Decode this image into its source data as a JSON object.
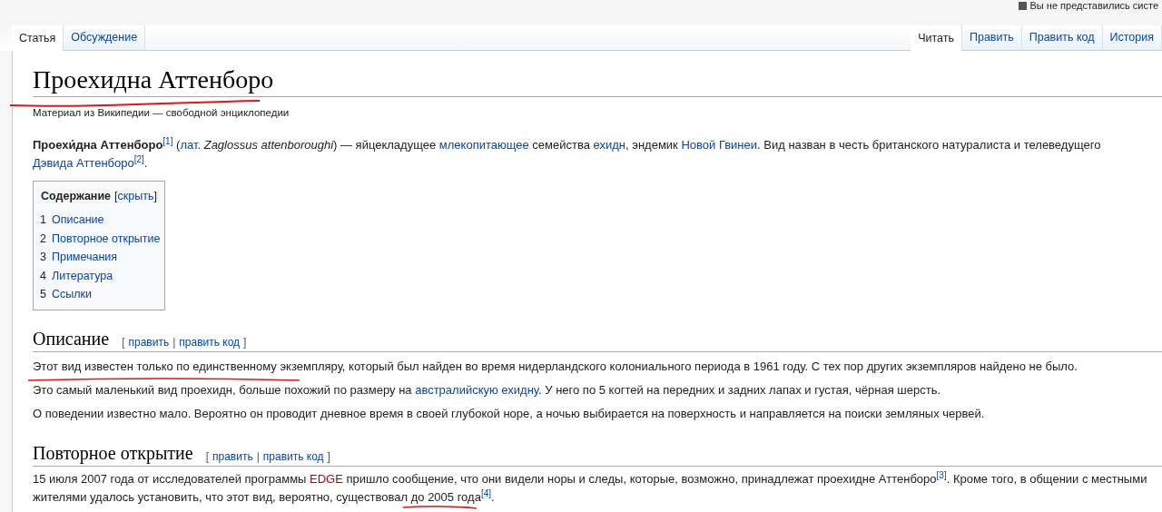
{
  "personal_bar": {
    "text": "Вы не представились систе"
  },
  "left_tabs": [
    {
      "label": "Статья",
      "selected": true
    },
    {
      "label": "Обсуждение",
      "selected": false
    }
  ],
  "right_tabs": [
    {
      "label": "Читать",
      "selected": true
    },
    {
      "label": "Править",
      "selected": false
    },
    {
      "label": "Править код",
      "selected": false
    },
    {
      "label": "История",
      "selected": false
    }
  ],
  "title": "Проехидна Аттенборо",
  "tagline": "Материал из Википедии — свободной энциклопедии",
  "intro": [
    {
      "kind": "bold",
      "text": "Проехи́дна Аттенборо"
    },
    {
      "kind": "ref",
      "text": "[1]"
    },
    {
      "kind": "plain",
      "text": " ("
    },
    {
      "kind": "link",
      "text": "лат."
    },
    {
      "kind": "italic",
      "text": " Zaglossus attenboroughi"
    },
    {
      "kind": "plain",
      "text": ") — яйцекладущее "
    },
    {
      "kind": "link",
      "text": "млекопитающее"
    },
    {
      "kind": "plain",
      "text": " семейства "
    },
    {
      "kind": "link",
      "text": "ехидн"
    },
    {
      "kind": "plain",
      "text": ", эндемик "
    },
    {
      "kind": "link",
      "text": "Новой Гвинеи"
    },
    {
      "kind": "plain",
      "text": ". Вид назван в честь британского натуралиста и телеведущего "
    },
    {
      "kind": "link",
      "text": "Дэвида Аттенборо"
    },
    {
      "kind": "ref",
      "text": "[2]"
    },
    {
      "kind": "plain",
      "text": "."
    }
  ],
  "toc": {
    "title": "Содержание",
    "toggle": {
      "open": "[",
      "label": "скрыть",
      "close": "]"
    },
    "items": [
      {
        "number": "1",
        "label": "Описание"
      },
      {
        "number": "2",
        "label": "Повторное открытие"
      },
      {
        "number": "3",
        "label": "Примечания"
      },
      {
        "number": "4",
        "label": "Литература"
      },
      {
        "number": "5",
        "label": "Ссылки"
      }
    ]
  },
  "sections": [
    {
      "heading": "Описание",
      "edit": {
        "open": "[",
        "links": [
          "править",
          "править код"
        ],
        "separator": "|",
        "close": "]"
      },
      "paragraphs": [
        [
          {
            "kind": "plain",
            "text": "Этот вид известен только по единственному экземпляру, который был найден во время нидерландского колониального периода в 1961 году. С тех пор других экземпляров найдено не было."
          }
        ],
        [
          {
            "kind": "plain",
            "text": "Это самый маленький вид проехидн, больше похожий по размеру на "
          },
          {
            "kind": "link",
            "text": "австралийскую ехидну"
          },
          {
            "kind": "plain",
            "text": ". У него по 5 когтей на передних и задних лапах и густая, чёрная шерсть."
          }
        ],
        [
          {
            "kind": "plain",
            "text": "О поведении известно мало. Вероятно он проводит дневное время в своей глубокой норе, а ночью выбирается на поверхность и направляется на поиски земляных червей."
          }
        ]
      ]
    },
    {
      "heading": "Повторное открытие",
      "edit": {
        "open": "[",
        "links": [
          "править",
          "править код"
        ],
        "separator": "|",
        "close": "]"
      },
      "paragraphs": [
        [
          {
            "kind": "plain",
            "text": "15 июля 2007 года от исследователей программы "
          },
          {
            "kind": "redlink",
            "text": "EDGE"
          },
          {
            "kind": "plain",
            "text": " пришло сообщение, что они видели норы и следы, которые, возможно, принадлежат проехидне Аттенборо"
          },
          {
            "kind": "ref",
            "text": "[3]"
          },
          {
            "kind": "plain",
            "text": ". Кроме того, в общении с местными жителями удалось установить, что этот вид, вероятно, существовал до 2005 года"
          },
          {
            "kind": "ref",
            "text": "[4]"
          },
          {
            "kind": "plain",
            "text": "."
          }
        ]
      ]
    }
  ]
}
